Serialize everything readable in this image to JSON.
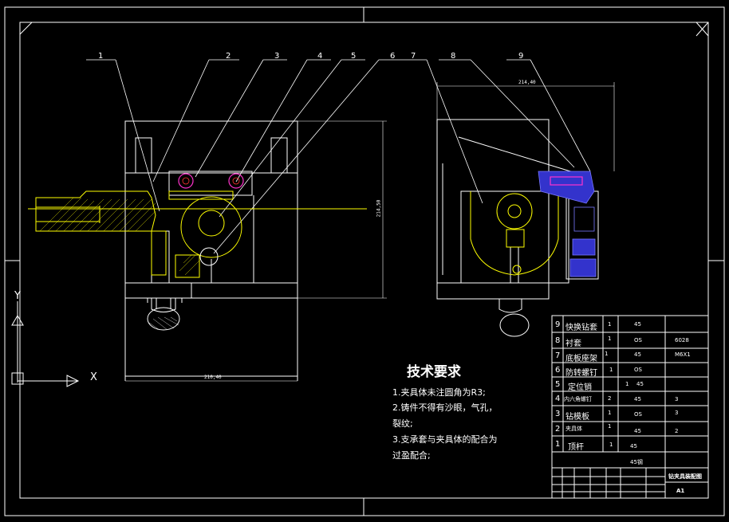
{
  "drawing": {
    "balloons": [
      "1",
      "2",
      "3",
      "4",
      "5",
      "6",
      "7",
      "8",
      "9"
    ],
    "dimensions": {
      "front_width": "210,40",
      "front_height": "214,50",
      "side_width": "214,40"
    },
    "axes": {
      "x": "X",
      "y": "Y"
    }
  },
  "tech_requirements": {
    "title": "技术要求",
    "lines": [
      "1.夹具体未注圆角为R3;",
      "2.铸件不得有沙眼，气孔，",
      "裂纹;",
      "3.支承套与夹具体的配合为",
      "过盈配合;"
    ]
  },
  "bom": {
    "rows": [
      {
        "no": "9",
        "name": "快换钻套",
        "qty": "1",
        "mat": "45",
        "spec": "",
        "note": ""
      },
      {
        "no": "8",
        "name": "衬套",
        "qty": "1",
        "mat": "OS",
        "spec": "",
        "note": "6028"
      },
      {
        "no": "7",
        "name": "底板座架",
        "qty": "1",
        "mat": "45",
        "spec": "",
        "note": "M6X1"
      },
      {
        "no": "6",
        "name": "防转螺钉",
        "qty": "1",
        "mat": "OS",
        "spec": "",
        "note": ""
      },
      {
        "no": "5",
        "name": "定位销",
        "qty": "1",
        "mat": "45",
        "spec": "",
        "note": ""
      },
      {
        "no": "4",
        "name": "内六角螺钉",
        "qty": "2",
        "mat": "45",
        "spec": "3",
        "note": ""
      },
      {
        "no": "3",
        "name": "钻模板",
        "qty": "1",
        "mat": "OS",
        "spec": "3",
        "note": ""
      },
      {
        "no": "2",
        "name": "夹具体",
        "qty": "1",
        "mat": "45",
        "spec": "2",
        "note": ""
      },
      {
        "no": "1",
        "name": "顶杆",
        "qty": "1",
        "mat": "45",
        "spec": "",
        "note": ""
      }
    ],
    "material": "45钢",
    "drawing_title": "钻夹具装配图",
    "scale": "A1"
  },
  "colors": {
    "line": "#ffffff",
    "yellow": "#ffff00",
    "magenta": "#ff33cc",
    "blue": "#3333cc",
    "red": "#ff3333"
  }
}
